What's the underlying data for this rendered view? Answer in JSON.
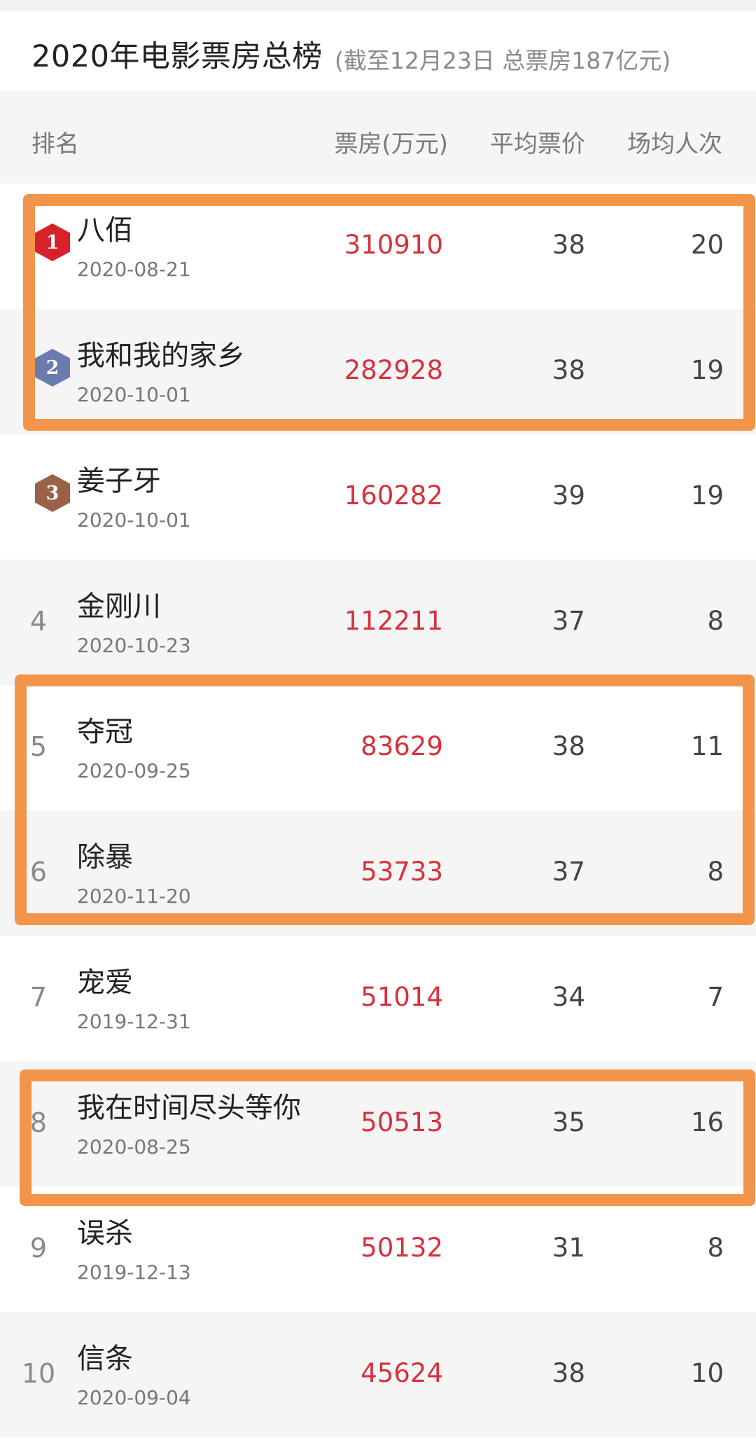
{
  "title": {
    "main": "2020年电影票房总榜",
    "sub": "(截至12月23日  总票房187亿元)"
  },
  "header": {
    "rank": "排名",
    "box_office": "票房(万元)",
    "avg_price": "平均票价",
    "avg_attendance": "场均人次"
  },
  "colors": {
    "box_office_value": "#d9303d",
    "highlight_border": "#f2954a",
    "medal_gold": "#d7222b",
    "medal_silver": "#6a7cad",
    "medal_bronze": "#9a6148"
  },
  "rows": [
    {
      "rank": "1",
      "medal": "medal-1-icon",
      "name": "八佰",
      "date": "2020-08-21",
      "box_office": "310910",
      "avg_price": "38",
      "avg_attendance": "20",
      "highlighted": true
    },
    {
      "rank": "2",
      "medal": "medal-2-icon",
      "name": "我和我的家乡",
      "date": "2020-10-01",
      "box_office": "282928",
      "avg_price": "38",
      "avg_attendance": "19",
      "highlighted": true
    },
    {
      "rank": "3",
      "medal": "medal-3-icon",
      "name": "姜子牙",
      "date": "2020-10-01",
      "box_office": "160282",
      "avg_price": "39",
      "avg_attendance": "19",
      "highlighted": false
    },
    {
      "rank": "4",
      "name": "金刚川",
      "date": "2020-10-23",
      "box_office": "112211",
      "avg_price": "37",
      "avg_attendance": "8",
      "highlighted": false
    },
    {
      "rank": "5",
      "name": "夺冠",
      "date": "2020-09-25",
      "box_office": "83629",
      "avg_price": "38",
      "avg_attendance": "11",
      "highlighted": true
    },
    {
      "rank": "6",
      "name": "除暴",
      "date": "2020-11-20",
      "box_office": "53733",
      "avg_price": "37",
      "avg_attendance": "8",
      "highlighted": true
    },
    {
      "rank": "7",
      "name": "宠爱",
      "date": "2019-12-31",
      "box_office": "51014",
      "avg_price": "34",
      "avg_attendance": "7",
      "highlighted": false
    },
    {
      "rank": "8",
      "name": "我在时间尽头等你",
      "date": "2020-08-25",
      "box_office": "50513",
      "avg_price": "35",
      "avg_attendance": "16",
      "highlighted": true
    },
    {
      "rank": "9",
      "name": "误杀",
      "date": "2019-12-13",
      "box_office": "50132",
      "avg_price": "31",
      "avg_attendance": "8",
      "highlighted": false
    },
    {
      "rank": "10",
      "name": "信条",
      "date": "2020-09-04",
      "box_office": "45624",
      "avg_price": "38",
      "avg_attendance": "10",
      "highlighted": false
    }
  ]
}
